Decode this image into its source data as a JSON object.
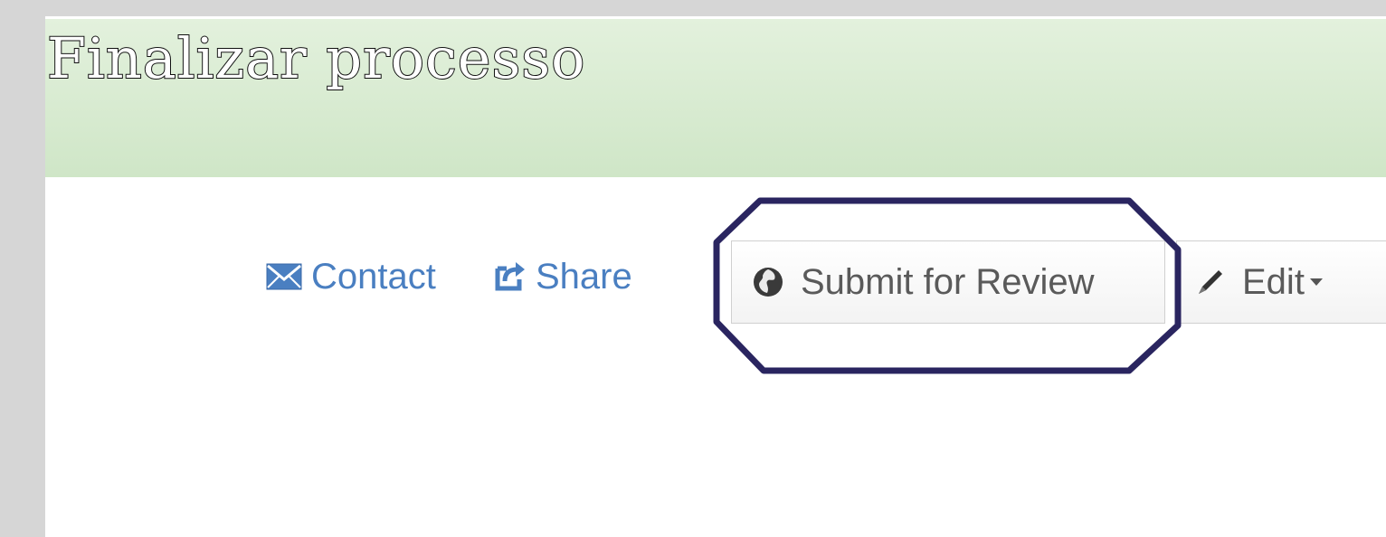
{
  "header": {
    "title": "Finalizar processo"
  },
  "actions": {
    "contact_label": "Contact",
    "contact_icon": "envelope-icon",
    "share_label": "Share",
    "share_icon": "share-icon",
    "submit_label": "Submit for Review",
    "submit_icon": "globe-icon",
    "edit_label": "Edit",
    "edit_icon": "pencil-icon"
  },
  "colors": {
    "header_band": "#cfe6c7",
    "link_blue": "#4a7fc1",
    "highlight_outline": "#2a2560",
    "frame_gray": "#d6d6d6"
  }
}
